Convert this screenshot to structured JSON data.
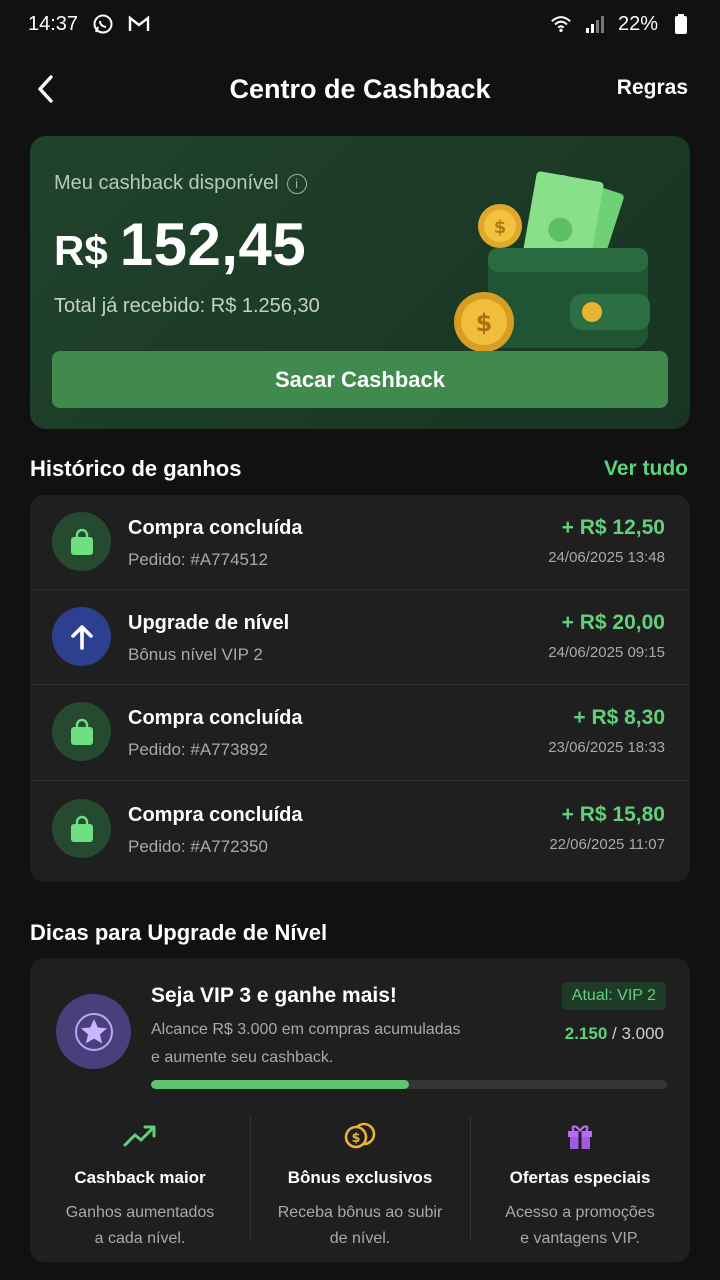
{
  "status_bar": {
    "time": "14:37",
    "battery": "22%"
  },
  "header": {
    "title": "Centro de Cashback",
    "rules": "Regras"
  },
  "balance": {
    "label": "Meu cashback disponível",
    "currency": "R$",
    "value": "152,45",
    "total_received": "Total já recebido: R$ 1.256,30",
    "withdraw_label": "Sacar Cashback"
  },
  "history": {
    "title": "Histórico de ganhos",
    "see_all": "Ver tudo",
    "items": [
      {
        "icon": "shopping-bag-icon",
        "title": "Compra concluída",
        "sub": "Pedido: #A774512",
        "amount": "+ R$ 12,50",
        "date": "24/06/2025 13:48"
      },
      {
        "icon": "arrow-up-icon",
        "title": "Upgrade de nível",
        "sub": "Bônus nível VIP 2",
        "amount": "+ R$ 20,00",
        "date": "24/06/2025 09:15"
      },
      {
        "icon": "shopping-bag-icon",
        "title": "Compra concluída",
        "sub": "Pedido: #A773892",
        "amount": "+ R$ 8,30",
        "date": "23/06/2025 18:33"
      },
      {
        "icon": "shopping-bag-icon",
        "title": "Compra concluída",
        "sub": "Pedido: #A772350",
        "amount": "+ R$ 15,80",
        "date": "22/06/2025 11:07"
      }
    ]
  },
  "tips": {
    "section_title": "Dicas para Upgrade de Nível",
    "title": "Seja VIP 3 e ganhe mais!",
    "desc_line1": "Alcance R$ 3.000 em compras acumuladas",
    "desc_line2": "e aumente seu cashback.",
    "current_level": "Atual: VIP 2",
    "progress_current": "2.150",
    "progress_target": " / 3.000",
    "progress_fraction": 0.5,
    "benefits": [
      {
        "icon": "trending-up-icon",
        "title": "Cashback maior",
        "desc_line1": "Ganhos aumentados",
        "desc_line2": "a cada nível."
      },
      {
        "icon": "coins-icon",
        "title": "Bônus exclusivos",
        "desc_line1": "Receba bônus ao subir",
        "desc_line2": "de nível."
      },
      {
        "icon": "gift-icon",
        "title": "Ofertas especiais",
        "desc_line1": "Acesso a promoções",
        "desc_line2": "e vantagens VIP."
      }
    ]
  },
  "colors": {
    "accent_green": "#5fd17a",
    "button_green": "#3f8a4c",
    "vip_purple": "#4a3f7a",
    "upgrade_blue": "#2d3f8f"
  }
}
